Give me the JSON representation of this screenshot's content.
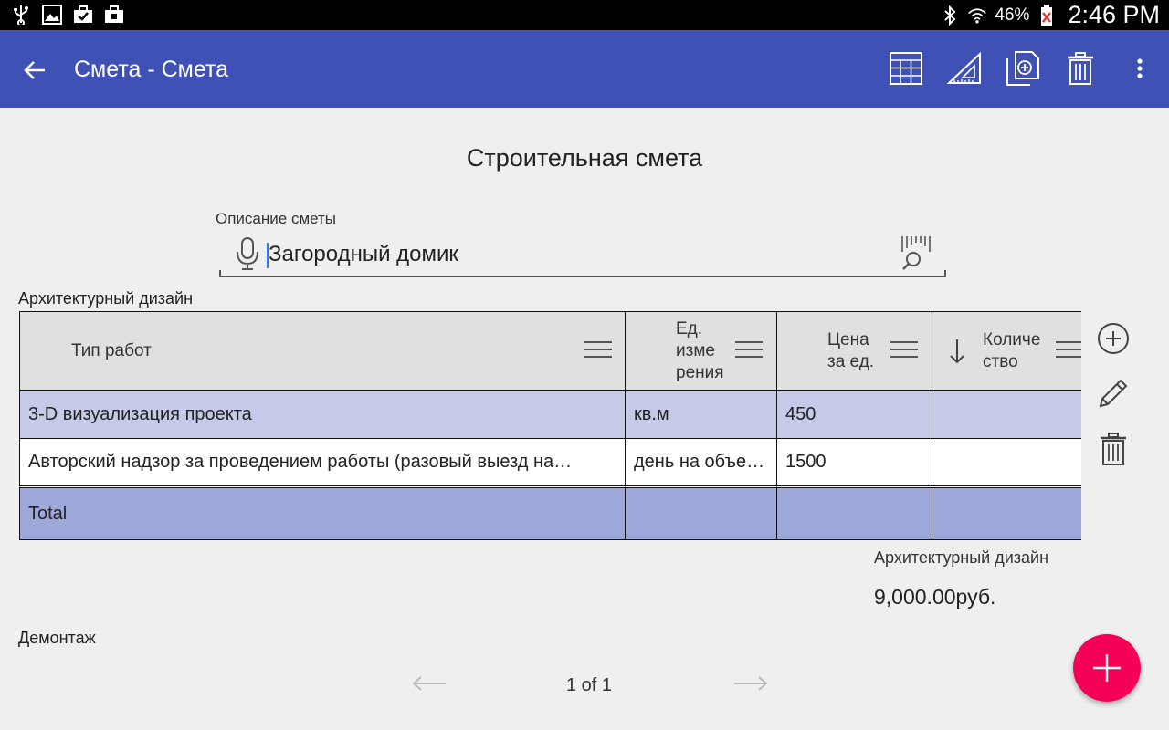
{
  "status_bar": {
    "battery_pct": "46%",
    "time": "2:46 PM",
    "icons": [
      "usb-icon",
      "image-icon",
      "briefcase-check-icon",
      "briefcase-icon",
      "bluetooth-icon",
      "wifi-icon",
      "battery-icon"
    ]
  },
  "appbar": {
    "title": "Смета - Смета",
    "actions": [
      "table-icon",
      "ruler-triangle-icon",
      "copy-add-icon",
      "trash-icon",
      "more-vert-icon"
    ],
    "color": "#3f51b5"
  },
  "page": {
    "heading": "Строительная смета",
    "description_label": "Описание сметы",
    "description_value": "Загородный домик"
  },
  "section1": {
    "label": "Архитектурный дизайн",
    "columns": [
      {
        "label": "Тип работ"
      },
      {
        "label_lines": [
          "Ед.",
          "изме",
          "рения"
        ]
      },
      {
        "label_lines": [
          "Цена",
          "за ед."
        ]
      },
      {
        "label_lines": [
          "Количе",
          "ство"
        ]
      }
    ],
    "rows": [
      {
        "type": "3-D визуализация проекта",
        "unit": "кв.м",
        "price": "450",
        "qty": ""
      },
      {
        "type": "Авторский надзор за проведением работы (разовый выезд на…",
        "unit": "день на объе…",
        "price": "1500",
        "qty": ""
      }
    ],
    "total_label": "Total",
    "summary_label": "Архитектурный дизайн",
    "summary_value": "9,000.00руб."
  },
  "section2": {
    "label": "Демонтаж"
  },
  "pager": {
    "label": "1 of 1"
  },
  "colors": {
    "row_selected": "#c5cae9",
    "row_total": "#9fa8da",
    "fab": "#f50057"
  }
}
